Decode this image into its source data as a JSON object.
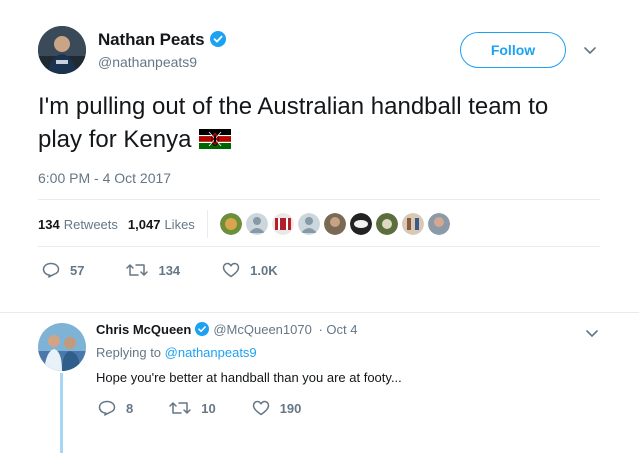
{
  "tweet": {
    "author_name": "Nathan Peats",
    "author_handle": "@nathanpeats9",
    "follow_label": "Follow",
    "text": "I'm pulling out of the Australian handball team to play for Kenya",
    "flag_icon": "kenya-flag-emoji",
    "timestamp": "6:00 PM - 4 Oct 2017",
    "retweets_count": "134",
    "retweets_label": "Retweets",
    "likes_count": "1,047",
    "likes_label": "Likes",
    "likers_count_shown": 10,
    "actions": {
      "reply_count": "57",
      "retweet_count": "134",
      "like_count": "1.0K"
    }
  },
  "reply": {
    "author_name": "Chris McQueen",
    "author_handle": "@McQueen1070",
    "date": "· Oct 4",
    "replying_to_prefix": "Replying to",
    "replying_to_handle": "@nathanpeats9",
    "text": "Hope you're better at handball than you are at footy...",
    "actions": {
      "reply_count": "8",
      "retweet_count": "10",
      "like_count": "190"
    }
  },
  "colors": {
    "accent": "#1da1f2",
    "muted": "#657786",
    "text": "#14171a",
    "divider": "#e6ecf0"
  }
}
